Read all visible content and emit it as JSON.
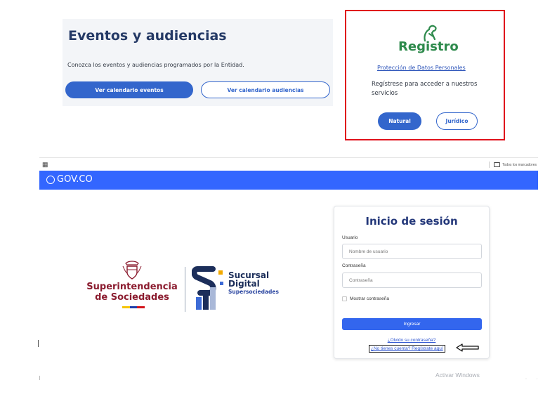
{
  "eventos": {
    "title": "Eventos y audiencias",
    "description": "Conozca los eventos y audiencias programados por la Entidad.",
    "btn_eventos": "Ver calendario eventos",
    "btn_audiencias": "Ver calendario audiencias"
  },
  "registro": {
    "logo_text": "Registro",
    "privacy_link": "Protección de Datos Personales",
    "description": "Regístrese para acceder a nuestros servicios",
    "btn_natural": "Natural",
    "btn_juridico": "Jurídico"
  },
  "browser": {
    "bookmarks_label": "Todos los marcadores"
  },
  "gov": {
    "logo_text": "GOV.CO"
  },
  "brand": {
    "superintendencia_line1": "Superintendencia",
    "superintendencia_line2": "de Sociedades",
    "sucursal_line1": "Sucursal",
    "sucursal_line2": "Digital",
    "sucursal_line3": "Supersociedades"
  },
  "login": {
    "title": "Inicio de sesión",
    "user_label": "Usuario",
    "user_placeholder": "Nombre de usuario",
    "password_label": "Contraseña",
    "password_placeholder": "Contraseña",
    "show_password": "Mostrar contraseña",
    "submit": "Ingresar",
    "forgot_link": "¿Olvido su contraseña?",
    "register_link": "¿No tienes cuenta? Regístrate aquí"
  },
  "watermark": "Activar Windows",
  "colors": {
    "primary_blue": "#3366cc",
    "gov_blue": "#3366ff",
    "highlight_red": "#e0111b",
    "registro_green": "#2e8a4c",
    "super_maroon": "#8b1c2f"
  }
}
